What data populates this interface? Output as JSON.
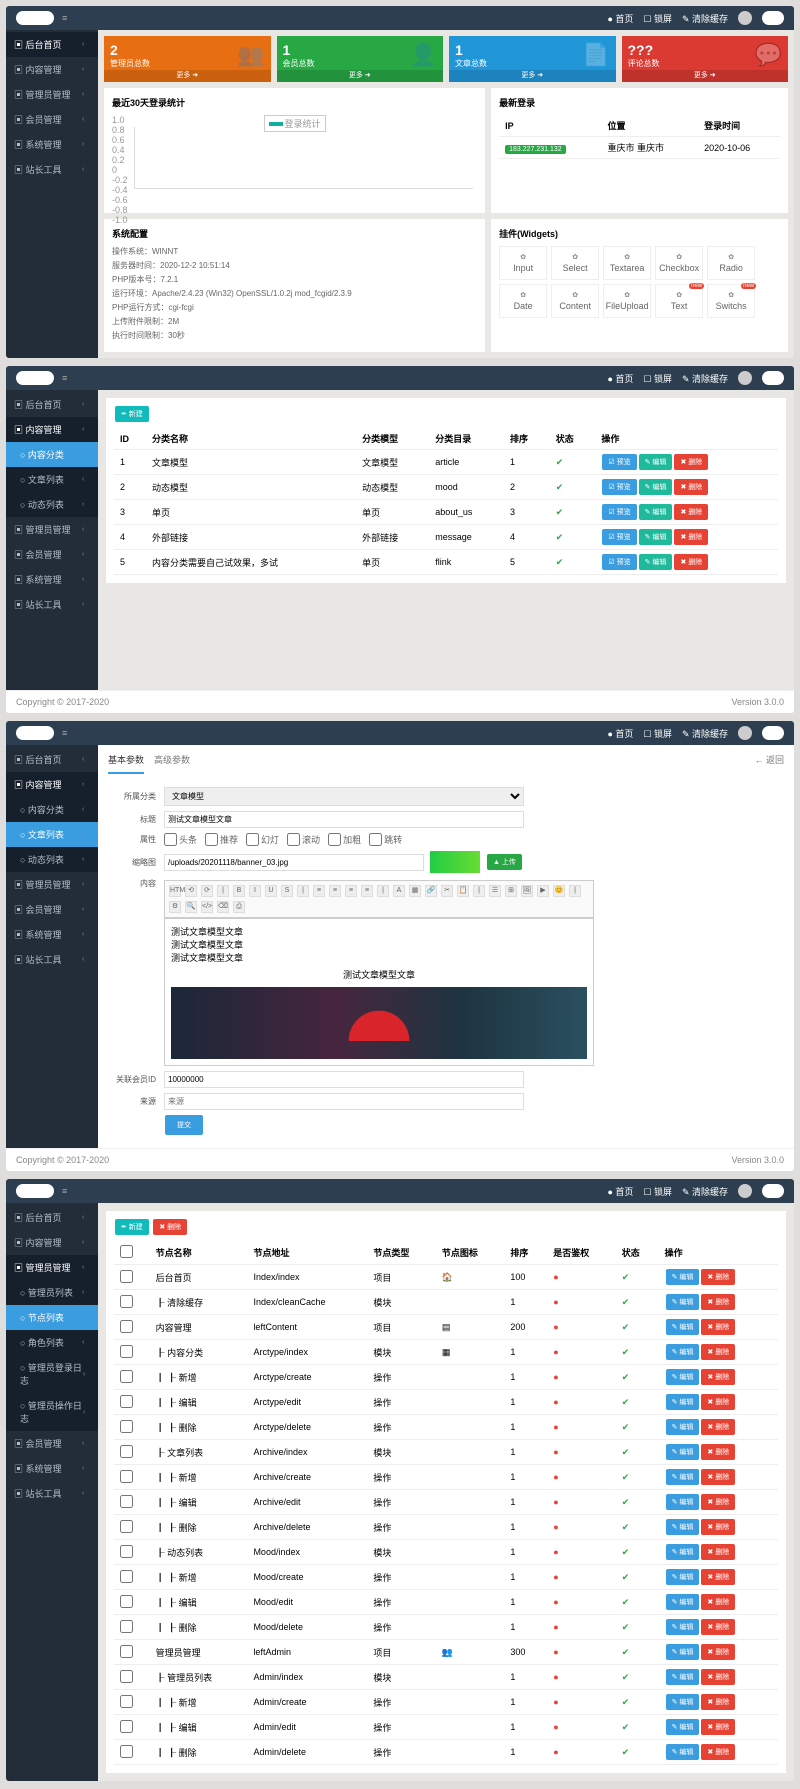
{
  "topbar": {
    "home": "● 首页",
    "lock": "☐ 锁屏",
    "clear": "✎ 清除缓存"
  },
  "sidebar": {
    "s1": [
      {
        "l": "后台首页",
        "a": true
      },
      {
        "l": "内容管理"
      },
      {
        "l": "管理员管理"
      },
      {
        "l": "会员管理"
      },
      {
        "l": "系统管理"
      },
      {
        "l": "站长工具"
      }
    ],
    "s2": [
      {
        "l": "后台首页"
      },
      {
        "l": "内容管理",
        "a": true
      },
      {
        "l": "内容分类",
        "sub": true,
        "hl": true
      },
      {
        "l": "文章列表",
        "sub": true
      },
      {
        "l": "动态列表",
        "sub": true
      },
      {
        "l": "管理员管理"
      },
      {
        "l": "会员管理"
      },
      {
        "l": "系统管理"
      },
      {
        "l": "站长工具"
      }
    ],
    "s3": [
      {
        "l": "后台首页"
      },
      {
        "l": "内容管理",
        "a": true
      },
      {
        "l": "内容分类",
        "sub": true
      },
      {
        "l": "文章列表",
        "sub": true,
        "hl": true
      },
      {
        "l": "动态列表",
        "sub": true
      },
      {
        "l": "管理员管理"
      },
      {
        "l": "会员管理"
      },
      {
        "l": "系统管理"
      },
      {
        "l": "站长工具"
      }
    ],
    "s4": [
      {
        "l": "后台首页"
      },
      {
        "l": "内容管理"
      },
      {
        "l": "管理员管理",
        "a": true
      },
      {
        "l": "管理员列表",
        "sub": true
      },
      {
        "l": "节点列表",
        "sub": true,
        "hl": true
      },
      {
        "l": "角色列表",
        "sub": true
      },
      {
        "l": "管理员登录日志",
        "sub": true
      },
      {
        "l": "管理员操作日志",
        "sub": true
      },
      {
        "l": "会员管理"
      },
      {
        "l": "系统管理"
      },
      {
        "l": "站长工具"
      }
    ]
  },
  "stats": [
    {
      "n": "2",
      "l": "管理员总数",
      "c": "#e76e12",
      "ico": "👥"
    },
    {
      "n": "1",
      "l": "会员总数",
      "c": "#27a845",
      "ico": "👤"
    },
    {
      "n": "1",
      "l": "文章总数",
      "c": "#2196d6",
      "ico": "📄"
    },
    {
      "n": "???",
      "l": "评论总数",
      "c": "#da3a32",
      "ico": "💬"
    }
  ],
  "more": "更多  ➜",
  "chart": {
    "title": "最近30天登录统计",
    "legend": "登录统计",
    "y": [
      "1.0",
      "0.8",
      "0.6",
      "0.4",
      "0.2",
      "0",
      "-0.2",
      "-0.4",
      "-0.6",
      "-0.8",
      "-1.0"
    ]
  },
  "login": {
    "title": "最新登录",
    "h": [
      "IP",
      "位置",
      "登录时间"
    ],
    "r": [
      [
        "183.227.231.132",
        "重庆市 重庆市",
        "2020-10-06"
      ]
    ]
  },
  "sys": {
    "title": "系统配置",
    "rows": [
      "操作系统：WINNT",
      "服务器时间：2020-12-2 10:51:14",
      "PHP版本号：7.2.1",
      "运行环境：Apache/2.4.23 (Win32) OpenSSL/1.0.2j mod_fcgid/2.3.9",
      "PHP运行方式：cgi-fcgi",
      "上传附件限制：2M",
      "执行时间限制：30秒"
    ]
  },
  "widgets": {
    "title": "挂件(Widgets)",
    "items": [
      "Input",
      "Select",
      "Textarea",
      "Checkbox",
      "Radio",
      "Date",
      "Content",
      "FileUpload",
      "Text",
      "Switchs"
    ],
    "new": "new"
  },
  "table2": {
    "btn": "✒ 新建",
    "h": [
      "ID",
      "分类名称",
      "分类模型",
      "分类目录",
      "排序",
      "状态",
      "操作"
    ],
    "r": [
      [
        "1",
        "文章模型",
        "文章模型",
        "article",
        "1"
      ],
      [
        "2",
        "动态模型",
        "动态模型",
        "mood",
        "2"
      ],
      [
        "3",
        "单页",
        "单页",
        "about_us",
        "3"
      ],
      [
        "4",
        "外部链接",
        "外部链接",
        "message",
        "4"
      ],
      [
        "5",
        "内容分类需要自己试效果，多试",
        "单页",
        "flink",
        "5"
      ]
    ],
    "actions": [
      "☑ 预览",
      "✎ 编辑",
      "✖ 删除"
    ]
  },
  "footer": {
    "l": "Copyright © 2017-2020",
    "r": "Version 3.0.0"
  },
  "form": {
    "tabs": [
      "基本参数",
      "高级参数"
    ],
    "back": "← 返回",
    "f_category": "所属分类",
    "v_category": "文章模型",
    "f_title": "标题",
    "v_title": "测试文章模型文章",
    "f_attr": "属性",
    "attrs": [
      "头条",
      "推荐",
      "幻灯",
      "滚动",
      "加粗",
      "跳转"
    ],
    "f_thumb": "缩略图",
    "v_thumb": "/uploads/20201118/banner_03.jpg",
    "btn_upload": "▲ 上传",
    "f_content": "内容",
    "lines": [
      "测试文章模型文章",
      "测试文章模型文章",
      "测试文章模型文章"
    ],
    "line4": "测试文章模型文章",
    "f_rel": "关联会员ID",
    "v_rel": "10000000",
    "f_src": "来源",
    "v_src": "来源",
    "submit": "提交"
  },
  "table4": {
    "btns": [
      "✒ 新建",
      "✖ 删除"
    ],
    "h": [
      "节点名称",
      "节点地址",
      "节点类型",
      "节点图标",
      "排序",
      "是否鉴权",
      "状态",
      "操作"
    ],
    "r": [
      {
        "name": "后台首页",
        "addr": "Index/index",
        "type": "项目",
        "icon": "🏠",
        "sort": "100",
        "auth": "r",
        "st": "g"
      },
      {
        "name": "┠ 清除缓存",
        "addr": "Index/cleanCache",
        "type": "模块",
        "icon": "",
        "sort": "1",
        "auth": "r",
        "st": "g"
      },
      {
        "name": "内容管理",
        "addr": "leftContent",
        "type": "项目",
        "icon": "▤",
        "sort": "200",
        "auth": "r",
        "st": "g"
      },
      {
        "name": "┠ 内容分类",
        "addr": "Arctype/index",
        "type": "模块",
        "icon": "▦",
        "sort": "1",
        "auth": "r",
        "st": "g"
      },
      {
        "name": "┃  ┠ 新增",
        "addr": "Arctype/create",
        "type": "操作",
        "icon": "",
        "sort": "1",
        "auth": "r",
        "st": "g"
      },
      {
        "name": "┃  ┠ 编辑",
        "addr": "Arctype/edit",
        "type": "操作",
        "icon": "",
        "sort": "1",
        "auth": "r",
        "st": "g"
      },
      {
        "name": "┃  ┠ 删除",
        "addr": "Arctype/delete",
        "type": "操作",
        "icon": "",
        "sort": "1",
        "auth": "r",
        "st": "g"
      },
      {
        "name": "┠ 文章列表",
        "addr": "Archive/index",
        "type": "模块",
        "icon": "",
        "sort": "1",
        "auth": "r",
        "st": "g"
      },
      {
        "name": "┃  ┠ 新增",
        "addr": "Archive/create",
        "type": "操作",
        "icon": "",
        "sort": "1",
        "auth": "r",
        "st": "g"
      },
      {
        "name": "┃  ┠ 编辑",
        "addr": "Archive/edit",
        "type": "操作",
        "icon": "",
        "sort": "1",
        "auth": "r",
        "st": "g"
      },
      {
        "name": "┃  ┠ 删除",
        "addr": "Archive/delete",
        "type": "操作",
        "icon": "",
        "sort": "1",
        "auth": "r",
        "st": "g"
      },
      {
        "name": "┠ 动态列表",
        "addr": "Mood/index",
        "type": "模块",
        "icon": "",
        "sort": "1",
        "auth": "r",
        "st": "g"
      },
      {
        "name": "┃  ┠ 新增",
        "addr": "Mood/create",
        "type": "操作",
        "icon": "",
        "sort": "1",
        "auth": "r",
        "st": "g"
      },
      {
        "name": "┃  ┠ 编辑",
        "addr": "Mood/edit",
        "type": "操作",
        "icon": "",
        "sort": "1",
        "auth": "r",
        "st": "g"
      },
      {
        "name": "┃  ┠ 删除",
        "addr": "Mood/delete",
        "type": "操作",
        "icon": "",
        "sort": "1",
        "auth": "r",
        "st": "g"
      },
      {
        "name": "管理员管理",
        "addr": "leftAdmin",
        "type": "项目",
        "icon": "👥",
        "sort": "300",
        "auth": "r",
        "st": "g"
      },
      {
        "name": "┠ 管理员列表",
        "addr": "Admin/index",
        "type": "模块",
        "icon": "",
        "sort": "1",
        "auth": "r",
        "st": "g"
      },
      {
        "name": "┃  ┠ 新增",
        "addr": "Admin/create",
        "type": "操作",
        "icon": "",
        "sort": "1",
        "auth": "r",
        "st": "g"
      },
      {
        "name": "┃  ┠ 编辑",
        "addr": "Admin/edit",
        "type": "操作",
        "icon": "",
        "sort": "1",
        "auth": "r",
        "st": "g"
      },
      {
        "name": "┃  ┠ 删除",
        "addr": "Admin/delete",
        "type": "操作",
        "icon": "",
        "sort": "1",
        "auth": "r",
        "st": "g"
      }
    ],
    "actions": [
      "✎ 编辑",
      "✖ 删除"
    ]
  },
  "chart_data": {
    "type": "line",
    "title": "最近30天登录统计",
    "ylabel": "",
    "ylim": [
      -1,
      1
    ],
    "categories": [],
    "values": []
  }
}
